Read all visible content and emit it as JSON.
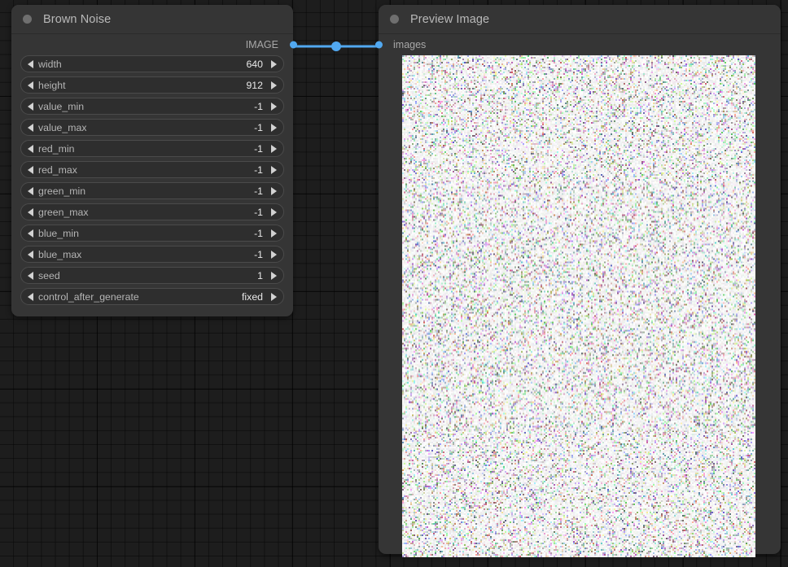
{
  "app": {
    "canvas_background": "#1d1d1d",
    "link_color": "#51a8f0",
    "node_background": "#353535"
  },
  "nodes": [
    {
      "id": "brown-noise",
      "title": "Brown Noise",
      "collapse_dot": "collapse-dot",
      "outputs": [
        {
          "label": "IMAGE",
          "type": "IMAGE",
          "color": "#51a8f0"
        }
      ],
      "inputs": [],
      "widgets": [
        {
          "name": "width",
          "value": "640"
        },
        {
          "name": "height",
          "value": "912"
        },
        {
          "name": "value_min",
          "value": "-1"
        },
        {
          "name": "value_max",
          "value": "-1"
        },
        {
          "name": "red_min",
          "value": "-1"
        },
        {
          "name": "red_max",
          "value": "-1"
        },
        {
          "name": "green_min",
          "value": "-1"
        },
        {
          "name": "green_max",
          "value": "-1"
        },
        {
          "name": "blue_min",
          "value": "-1"
        },
        {
          "name": "blue_max",
          "value": "-1"
        },
        {
          "name": "seed",
          "value": "1"
        },
        {
          "name": "control_after_generate",
          "value": "fixed"
        }
      ]
    },
    {
      "id": "preview-image",
      "title": "Preview Image",
      "collapse_dot": "collapse-dot",
      "inputs": [
        {
          "label": "images",
          "type": "IMAGE",
          "color": "#51a8f0"
        }
      ],
      "outputs": [],
      "widgets": [],
      "preview": {
        "alt": "brown-noise-preview",
        "base_color": "#f6f4f7"
      }
    }
  ],
  "links": [
    {
      "from_node": "brown-noise",
      "from_slot": "IMAGE",
      "to_node": "preview-image",
      "to_slot": "images",
      "color": "#51a8f0"
    }
  ]
}
